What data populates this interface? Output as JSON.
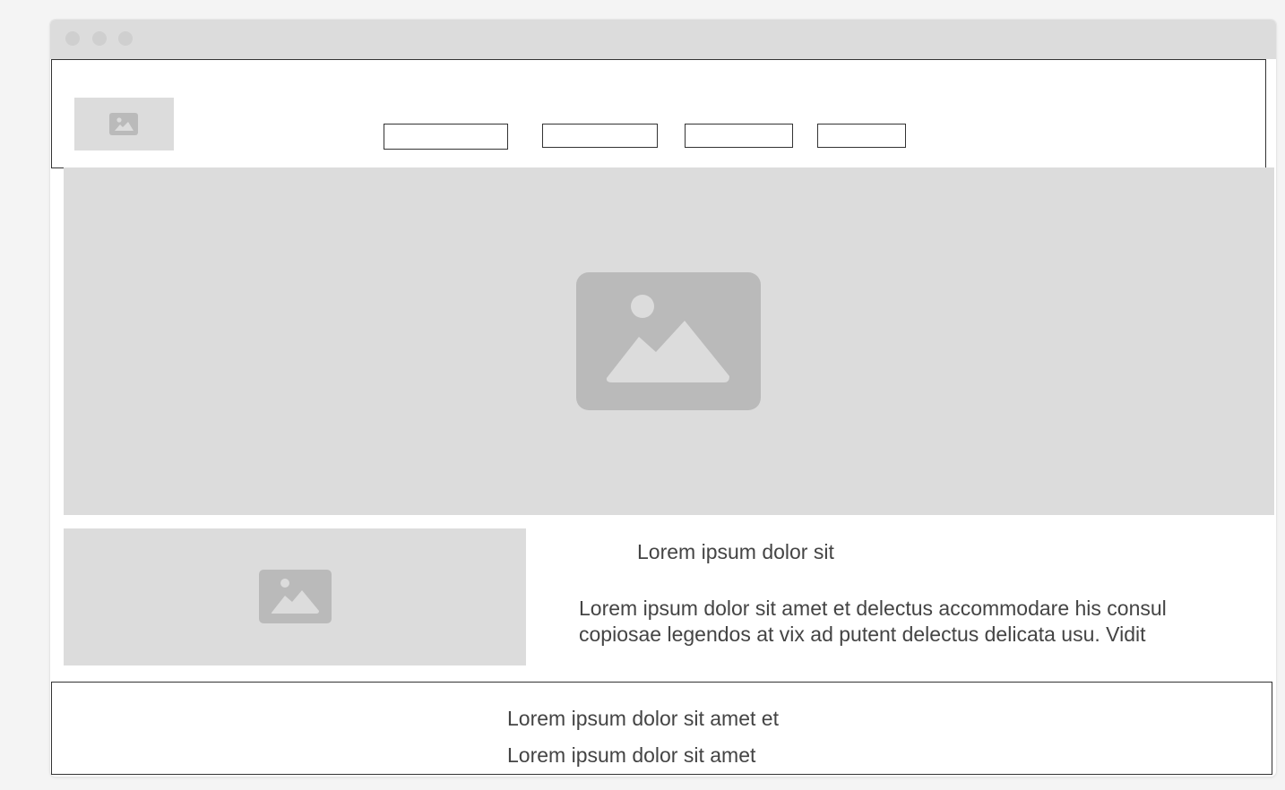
{
  "window": {
    "controls": [
      "close",
      "minimize",
      "maximize"
    ]
  },
  "header": {
    "logo_icon": "image-icon",
    "nav_items": [
      "",
      "",
      "",
      ""
    ]
  },
  "hero": {
    "icon": "image-icon"
  },
  "feature": {
    "icon": "image-icon",
    "heading": "Lorem ipsum dolor sit",
    "body_line1": "Lorem ipsum dolor sit amet et delectus accommodare his consul",
    "body_line2": "copiosae legendos at vix ad putent delectus delicata usu. Vidit"
  },
  "footer": {
    "line1": "Lorem ipsum dolor sit amet et",
    "line2": "Lorem ipsum dolor sit amet"
  },
  "colors": {
    "page_bg": "#f4f4f4",
    "placeholder_bg": "#dcdcdc",
    "placeholder_icon": "#bababa",
    "border": "#333333",
    "text": "#444444"
  }
}
